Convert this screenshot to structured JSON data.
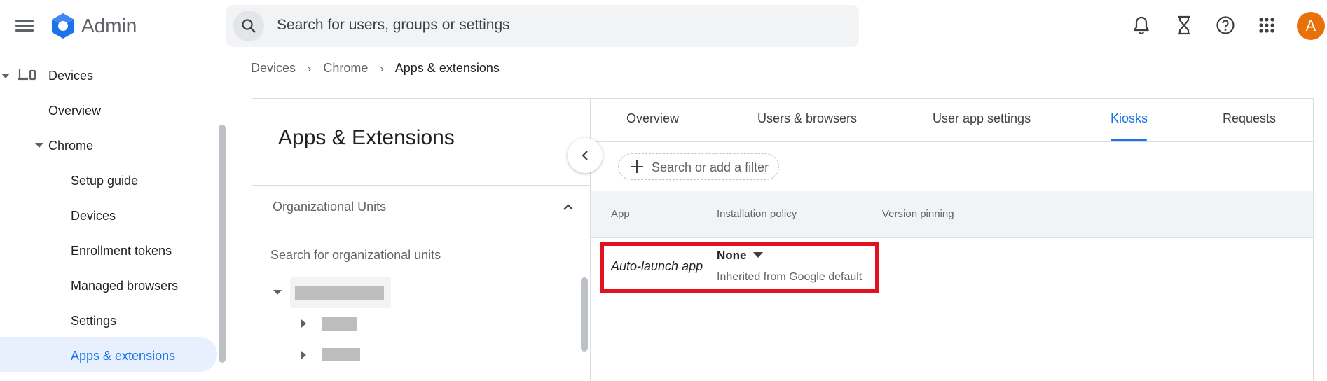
{
  "app": {
    "name": "Admin",
    "brand_color": "#1a73e8",
    "avatar_letter": "A",
    "avatar_color": "#e8710a"
  },
  "search": {
    "placeholder": "Search for users, groups or settings"
  },
  "top_icons": [
    "notifications-icon",
    "hourglass-icon",
    "help-icon",
    "apps-grid-icon"
  ],
  "sidebar": {
    "items": [
      {
        "label": "Devices",
        "level": 0,
        "expanded": true
      },
      {
        "label": "Overview",
        "level": 1
      },
      {
        "label": "Chrome",
        "level": 1,
        "expanded": true
      },
      {
        "label": "Setup guide",
        "level": 2
      },
      {
        "label": "Devices",
        "level": 2
      },
      {
        "label": "Enrollment tokens",
        "level": 2
      },
      {
        "label": "Managed browsers",
        "level": 2
      },
      {
        "label": "Settings",
        "level": 2
      },
      {
        "label": "Apps & extensions",
        "level": 2,
        "active": true
      }
    ]
  },
  "breadcrumb": {
    "items": [
      "Devices",
      "Chrome",
      "Apps & extensions"
    ]
  },
  "left_panel": {
    "title": "Apps & Extensions",
    "ou_label": "Organizational Units",
    "ou_search_placeholder": "Search for organizational units"
  },
  "tabs": [
    {
      "label": "Overview"
    },
    {
      "label": "Users & browsers"
    },
    {
      "label": "User app settings"
    },
    {
      "label": "Kiosks",
      "active": true
    },
    {
      "label": "Requests"
    }
  ],
  "filter": {
    "placeholder": "Search or add a filter"
  },
  "table": {
    "columns": [
      "App",
      "Installation policy",
      "Version pinning"
    ],
    "rows": [
      {
        "app": "Auto-launch app",
        "policy": "None",
        "policy_note": "Inherited from Google default"
      }
    ]
  },
  "highlight_color": "#e0121f"
}
